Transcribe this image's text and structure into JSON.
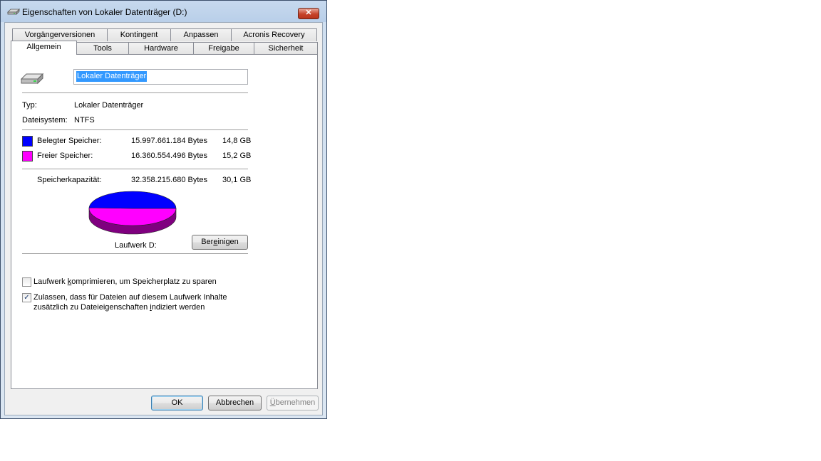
{
  "window": {
    "title": "Eigenschaften von Lokaler Datenträger (D:)",
    "close_label": "✕"
  },
  "tabs_row1": [
    {
      "label": "Vorgängerversionen"
    },
    {
      "label": "Kontingent"
    },
    {
      "label": "Anpassen"
    },
    {
      "label": "Acronis Recovery"
    }
  ],
  "tabs_row2": [
    {
      "label": "Allgemein",
      "active": true
    },
    {
      "label": "Tools"
    },
    {
      "label": "Hardware"
    },
    {
      "label": "Freigabe"
    },
    {
      "label": "Sicherheit"
    }
  ],
  "general": {
    "drive_name": "Lokaler Datenträger",
    "type_label": "Typ:",
    "type_value": "Lokaler Datenträger",
    "fs_label": "Dateisystem:",
    "fs_value": "NTFS",
    "used": {
      "label": "Belegter Speicher:",
      "bytes": "15.997.661.184 Bytes",
      "size": "14,8 GB",
      "color": "#0000ff"
    },
    "free": {
      "label": "Freier Speicher:",
      "bytes": "16.360.554.496 Bytes",
      "size": "15,2 GB",
      "color": "#ff00ff"
    },
    "capacity": {
      "label": "Speicherkapazität:",
      "bytes": "32.358.215.680 Bytes",
      "size": "30,1 GB"
    },
    "drive_label": "Laufwerk D:",
    "cleanup_button": {
      "pre": "Ber",
      "accel": "e",
      "post": "inigen"
    },
    "compress": {
      "pre": "Laufwerk ",
      "accel": "k",
      "post": "omprimieren, um Speicherplatz zu sparen",
      "checked": false
    },
    "index": {
      "line1": "Zulassen, dass für Dateien auf diesem Laufwerk Inhalte",
      "line2_pre": "zusätzlich zu Dateieigenschaften ",
      "line2_accel": "i",
      "line2_post": "ndiziert werden",
      "checked": true
    }
  },
  "buttons": {
    "ok": "OK",
    "cancel": "Abbrechen",
    "apply": {
      "accel": "Ü",
      "post": "bernehmen"
    }
  },
  "pie": {
    "used_fraction": 0.494,
    "used_color": "#0000ff",
    "free_color": "#ff00ff",
    "free_side_color": "#7f007f"
  },
  "check_mark": "✓"
}
